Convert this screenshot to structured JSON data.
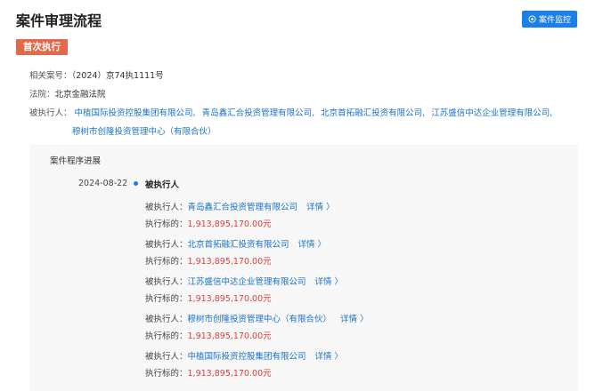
{
  "header": {
    "title": "案件审理流程",
    "monitor_button": "案件监控"
  },
  "stage_tag": "首次执行",
  "case_info": {
    "case_no_label": "相关案号：",
    "case_no": "（2024）京74执1111号",
    "court_label": "法院：",
    "court": "北京金融法院",
    "respondent_label": "被执行人：",
    "respondents": [
      "中植国际投资控股集团有限公司,",
      "青岛鑫汇合投资管理有限公司,",
      "北京首拓融汇投资有限公司,",
      "江苏盛信中达企业管理有限公司,",
      "穆树市创隆投资管理中心（有限合伙）"
    ]
  },
  "progress": {
    "title": "案件程序进展",
    "date": "2024-08-22",
    "event": "被执行人",
    "entries": [
      {
        "label": "被执行人：",
        "name": "青岛鑫汇合投资管理有限公司",
        "detail": "详情 〉",
        "amount_label": "执行标的：",
        "amount": "1,913,895,170.00元"
      },
      {
        "label": "被执行人：",
        "name": "北京首拓融汇投资有限公司",
        "detail": "详情 〉",
        "amount_label": "执行标的：",
        "amount": "1,913,895,170.00元"
      },
      {
        "label": "被执行人：",
        "name": "江苏盛信中达企业管理有限公司",
        "detail": "详情 〉",
        "amount_label": "执行标的：",
        "amount": "1,913,895,170.00元"
      },
      {
        "label": "被执行人：",
        "name": "穆树市创隆投资管理中心（有限合伙）",
        "detail": "详情 〉",
        "amount_label": "执行标的：",
        "amount": "1,913,895,170.00元"
      },
      {
        "label": "被执行人：",
        "name": "中植国际投资控股集团有限公司",
        "detail": "详情 〉",
        "amount_label": "执行标的：",
        "amount": "1,913,895,170.00元"
      }
    ]
  }
}
